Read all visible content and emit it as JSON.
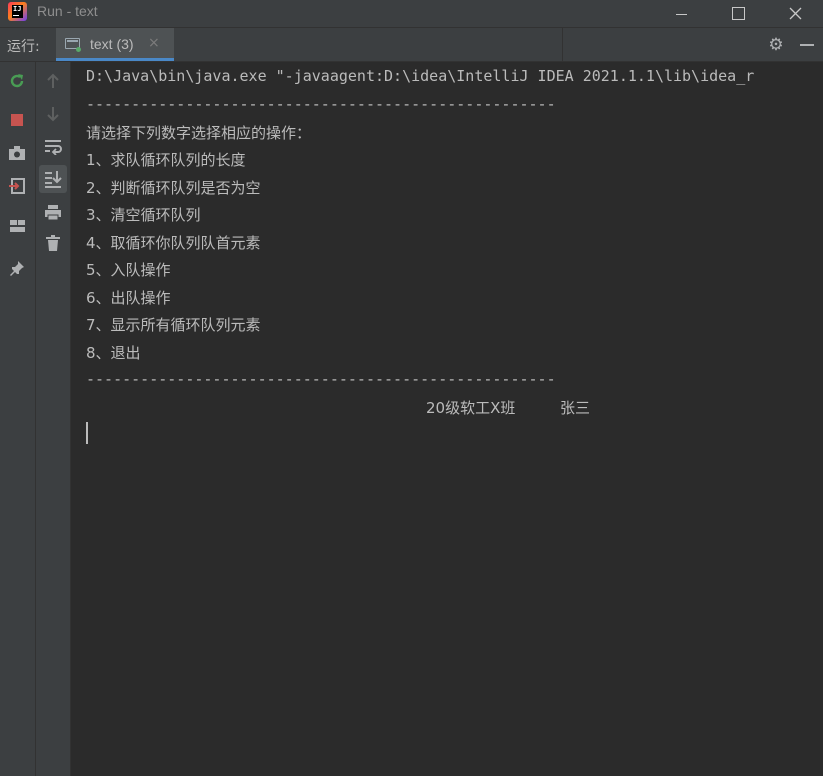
{
  "window": {
    "title": "Run - text",
    "controls": [
      "minimize",
      "maximize",
      "close"
    ]
  },
  "tool_window": {
    "label": "运行:",
    "tab": {
      "label": "text (3)",
      "close": "×",
      "icon": "console-tab-icon"
    },
    "actions": [
      "settings-gear-icon",
      "hide-minus-icon"
    ]
  },
  "left_toolbar": [
    "rerun-icon",
    "stop-icon",
    "screenshot-camera-icon",
    "restore-layout-icon",
    "layout-icon",
    "pin-icon"
  ],
  "console_toolbar": [
    "up-arrow-icon",
    "down-arrow-icon",
    "soft-wrap-icon",
    "scroll-to-end-icon",
    "print-icon",
    "trash-icon"
  ],
  "console": {
    "command": "D:\\Java\\bin\\java.exe \"-javaagent:D:\\idea\\IntelliJ IDEA 2021.1.1\\lib\\idea_r",
    "divider_top": "----------------------------------------------------",
    "prompt": "请选择下列数字选择相应的操作：",
    "menu": [
      "1、求队循环队列的长度",
      "2、判断循环队列是否为空",
      "3、清空循环队列",
      "4、取循环你队列队首元素",
      "5、入队操作",
      "6、出队操作",
      "7、显示所有循环队列元素",
      "8、退出"
    ],
    "divider_bottom": "----------------------------------------------------",
    "footer_class": "20级软工X班",
    "footer_name": "张三"
  },
  "colors": {
    "background": "#2b2b2b",
    "panel": "#3c3f41",
    "text": "#bbbbbb",
    "accent": "#4a88c7",
    "rerun_green": "#499c54",
    "stop_red": "#c75450"
  }
}
